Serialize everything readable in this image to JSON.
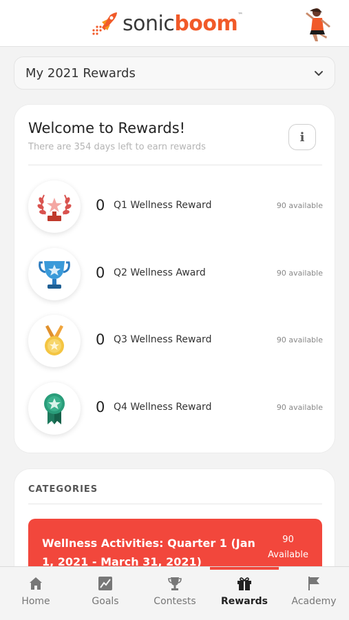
{
  "header": {
    "logo_sonic": "sonic",
    "logo_boom": "boom",
    "logo_tm": "™",
    "brand_color": "#f15a29"
  },
  "selector": {
    "label": "My 2021 Rewards"
  },
  "welcome": {
    "title": "Welcome to Rewards!",
    "subtitle": "There are 354 days left to earn rewards",
    "info_icon": "i"
  },
  "rewards": [
    {
      "count": "0",
      "name": "Q1 Wellness Reward",
      "available": "90 available",
      "icon": "laurel-trophy-icon"
    },
    {
      "count": "0",
      "name": "Q2 Wellness Award",
      "available": "90 available",
      "icon": "blue-cup-icon"
    },
    {
      "count": "0",
      "name": "Q3 Wellness Reward",
      "available": "90 available",
      "icon": "gold-medal-icon"
    },
    {
      "count": "0",
      "name": "Q4 Wellness Reward",
      "available": "90 available",
      "icon": "green-ribbon-icon"
    }
  ],
  "categories": {
    "title": "CATEGORIES",
    "items": [
      {
        "title": "Wellness Activities: Quarter 1 (Jan 1, 2021 - March 31, 2021)",
        "count": "90",
        "count_label": "Available",
        "color": "#f2473c"
      }
    ]
  },
  "tabs": [
    {
      "label": "Home",
      "icon": "home-icon"
    },
    {
      "label": "Goals",
      "icon": "chart-icon"
    },
    {
      "label": "Contests",
      "icon": "trophy-icon"
    },
    {
      "label": "Rewards",
      "icon": "gift-icon",
      "active": true
    },
    {
      "label": "Academy",
      "icon": "flag-icon"
    }
  ]
}
